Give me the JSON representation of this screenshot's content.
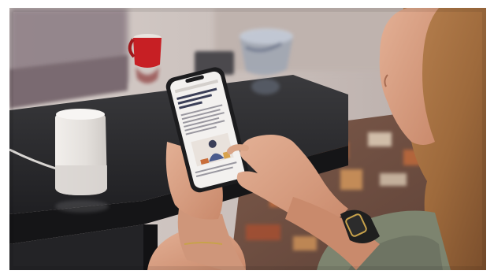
{
  "photo": {
    "subject": "photo-of-woman-using-smartphone",
    "palette": {
      "background_wall": "#cfc6c2",
      "table_dark": "#2b2a2c",
      "mug_red": "#c71f24",
      "smart_speaker": "#e6e3e0",
      "phone_body": "#1c1c1e",
      "phone_screen": "#f3f1ef",
      "skin": "#d9a486",
      "hair": "#a56f3f",
      "rug_orange": "#c96e3b",
      "watch_band": "#1f1f1f",
      "gold": "#c8a24b"
    }
  }
}
